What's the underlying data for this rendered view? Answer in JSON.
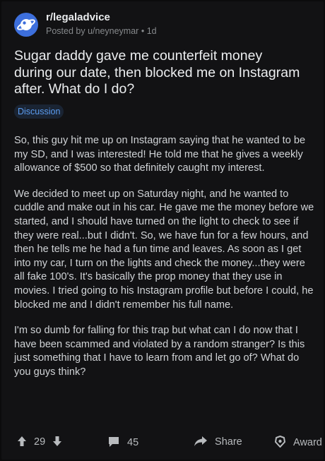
{
  "post": {
    "subreddit": "r/legaladvice",
    "posted_by": "Posted by u/neyneymar",
    "separator": "•",
    "age": "1d",
    "title": "Sugar daddy gave me counterfeit money during our date, then blocked me on Instagram after. What do I do?",
    "flair": "Discussion",
    "paragraphs": [
      "So, this guy hit me up on Instagram saying that he wanted to be my SD, and I was interested! He told me that he gives a weekly allowance of $500 so that definitely caught my interest.",
      "We decided to meet up on Saturday night, and he wanted to cuddle and make out in his car. He gave me the money before we started, and I should have turned on the light to check to see if they were real...but I didn't. So, we have fun for a few hours, and then he tells me he had a fun time and leaves. As soon as I get into my car, I turn on the lights and check the money...they were all fake 100's. It's basically the prop money that they use in movies. I tried going to his Instagram profile but before I could, he blocked me and I didn't remember his full name.",
      "I'm so dumb for falling for this trap but what can I do now that I have been scammed and violated by a random stranger? Is this just something that I have to learn from and let go of? What do you guys think?"
    ]
  },
  "actions": {
    "votes": "29",
    "comments": "45",
    "share": "Share",
    "award": "Award"
  },
  "colors": {
    "background": "#121214",
    "flair_text": "#5c9df1",
    "avatar": "#3d6fdc"
  },
  "icons": [
    "planet-icon",
    "upvote-icon",
    "downvote-icon",
    "comment-icon",
    "share-icon",
    "award-icon"
  ]
}
